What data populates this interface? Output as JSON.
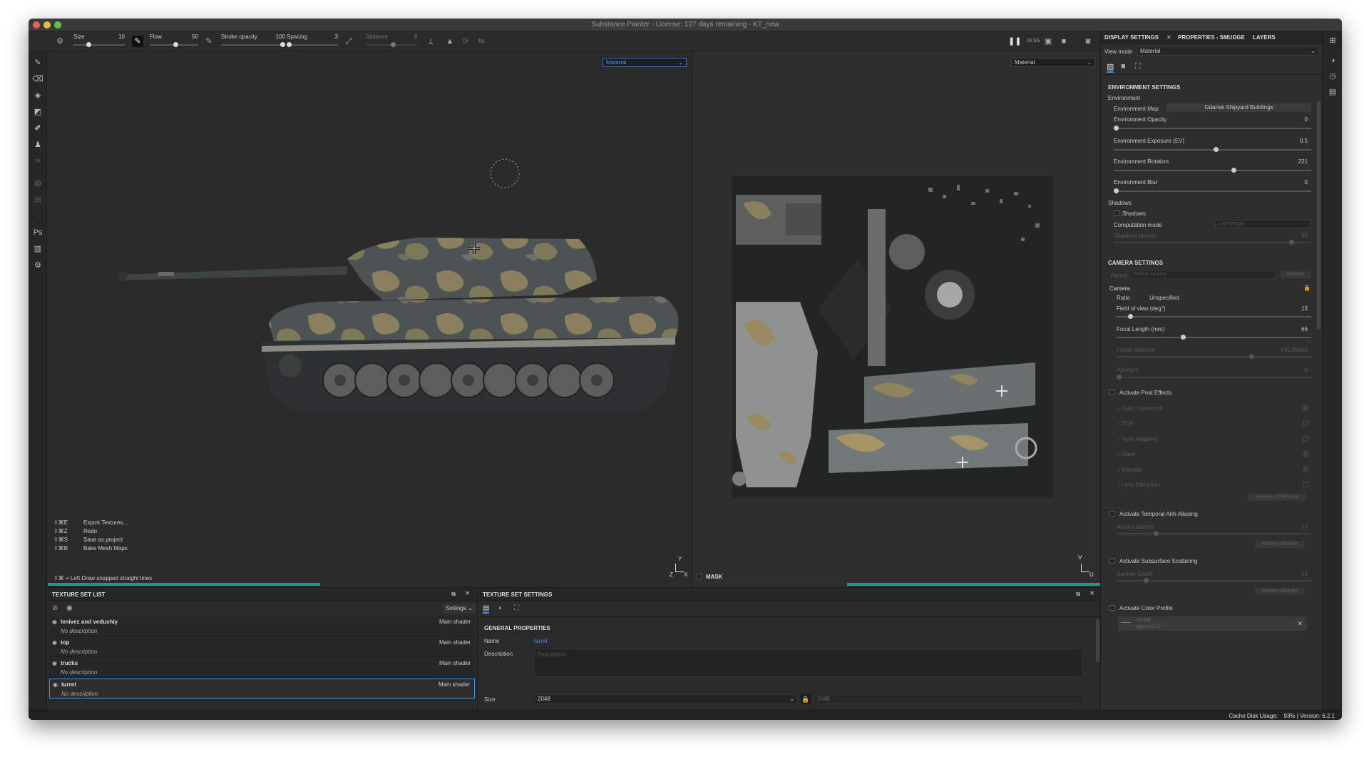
{
  "window": {
    "title": "Substance Painter - License: 127 days remaining - KT_new"
  },
  "colors": {
    "close": "#ec5f57",
    "min": "#e5bb3c",
    "max": "#5fc24e",
    "accent": "#1f9b84",
    "link": "#3f8ee8"
  },
  "toolbar": {
    "size": {
      "label": "Size",
      "value": "10"
    },
    "flow": {
      "label": "Flow",
      "value": "50"
    },
    "stroke_opacity": {
      "label": "Stroke opacity",
      "value": "100"
    },
    "spacing": {
      "label": "Spacing",
      "value": "3"
    },
    "distance": {
      "label": "Distance",
      "value": "8"
    },
    "dlss": "DLSS"
  },
  "viewport3d": {
    "mode": "Material",
    "shortcuts": [
      {
        "keys": "⇧⌘E",
        "label": "Export Textures..."
      },
      {
        "keys": "⇧⌘Z",
        "label": "Redo"
      },
      {
        "keys": "⇧⌘S",
        "label": "Save as project"
      },
      {
        "keys": "⇧⌘B",
        "label": "Bake Mesh Maps"
      }
    ],
    "hint_keys": "⇧⌘ + Left",
    "hint_label": "Draw snapped straight lines",
    "axis_z": "Z",
    "axis_x": "X",
    "axis_y": "Y"
  },
  "viewport2d": {
    "mode": "Material",
    "mask": "MASK",
    "axis_v": "V",
    "axis_u": "U"
  },
  "right_panel": {
    "tabs": [
      "DISPLAY SETTINGS",
      "PROPERTIES - SMUDGE",
      "LAYERS"
    ],
    "view_mode_label": "View mode",
    "view_mode_value": "Material",
    "env_title": "ENVIRONMENT SETTINGS",
    "env_group": "Environment",
    "env_map_label": "Environment Map",
    "env_map_value": "Gdansk Shipyard Buildings",
    "env_opacity": {
      "label": "Environment Opacity",
      "value": "0",
      "frac": 0.0
    },
    "env_exposure": {
      "label": "Environment Exposure (EV)",
      "value": "0.5",
      "frac": 0.52
    },
    "env_rotation": {
      "label": "Environment Rotation",
      "value": "221",
      "frac": 0.61
    },
    "env_blur": {
      "label": "Environment Blur",
      "value": "0",
      "frac": 0.0
    },
    "shadows_group": "Shadows",
    "shadows_cb": "Shadows",
    "computation_label": "Computation mode",
    "computation_value": "Lightweight",
    "shadows_opacity": {
      "label": "Shadows opacity",
      "value": "90",
      "frac": 0.9
    },
    "cam_title": "CAMERA SETTINGS",
    "preset_label": "Preset",
    "preset_value": "Default camera",
    "restore": "Restore",
    "camera_group": "Camera",
    "ratio_label": "Ratio",
    "ratio_value": "Unspecified",
    "fov": {
      "label": "Field of view (deg°)",
      "value": "13",
      "frac": 0.07
    },
    "focal": {
      "label": "Focal Length (mm)",
      "value": "66",
      "frac": 0.34
    },
    "focus": {
      "label": "Focus distance",
      "value": "145.96258",
      "frac": 0.71
    },
    "aperture": {
      "label": "Aperture",
      "value": "0",
      "frac": 0.0
    },
    "post_effects": "Activate Post Effects",
    "effects": [
      "Color Correction",
      "DOF",
      "Tone Mapping",
      "Glare",
      "Vignette",
      "Lens Distortion"
    ],
    "restore_all": "Restore all defaults",
    "taa": "Activate Temporal Anti-Aliasing",
    "accum": {
      "label": "Accumulations",
      "value": "16",
      "frac": 0.2
    },
    "restore_defaults": "Restore defaults",
    "sss": "Activate Subsurface Scattering",
    "sample": {
      "label": "Sample Count",
      "value": "16",
      "frac": 0.15
    },
    "color_profile": "Activate Color Profile",
    "profile_label": "Profile",
    "profile_value": "gamma2.2"
  },
  "texture_set_list": {
    "title": "TEXTURE SET LIST",
    "settings": "Settings",
    "items": [
      {
        "name": "lenivez and vedushiy",
        "shader": "Main shader",
        "desc": "No description"
      },
      {
        "name": "top",
        "shader": "Main shader",
        "desc": "No description"
      },
      {
        "name": "trucks",
        "shader": "Main shader",
        "desc": "No description"
      },
      {
        "name": "turret",
        "shader": "Main shader",
        "desc": "No description"
      }
    ]
  },
  "texture_set_settings": {
    "title": "TEXTURE SET SETTINGS",
    "general": "GENERAL PROPERTIES",
    "name_label": "Name",
    "name_value": "turret",
    "desc_label": "Description",
    "desc_placeholder": "Description",
    "size_label": "Size",
    "size_value": "2048",
    "size_value2": "2048"
  },
  "status": {
    "cache_label": "Cache Disk Usage:",
    "cache_value": "93% | Version: 6.2.1"
  }
}
